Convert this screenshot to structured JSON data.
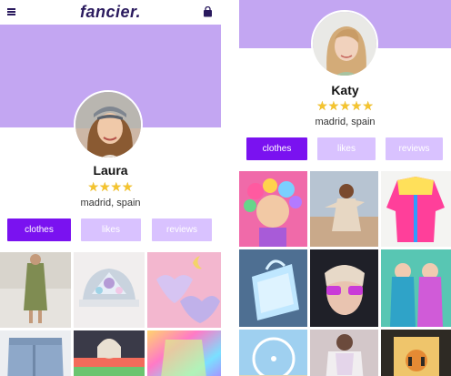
{
  "app": {
    "brand": "fancier.",
    "accent": "#7a12f0",
    "tab_inactive": "#d9c2ff",
    "banner": "#c3a6f2"
  },
  "header": {
    "menu_icon": "hamburger-menu-icon",
    "bag_icon": "shopping-bag-icon"
  },
  "profiles": [
    {
      "name": "Laura",
      "rating": "★★★★",
      "rating_value": 4,
      "location": "madrid, spain",
      "tabs": [
        {
          "label": "clothes",
          "active": true
        },
        {
          "label": "likes",
          "active": false
        },
        {
          "label": "reviews",
          "active": false
        }
      ],
      "photos": [
        "green-dress-photo",
        "jeweled-cap-photo",
        "heart-glasses-photo",
        "denim-shorts-photo",
        "rainbow-outfit-photo",
        "holographic-top-photo"
      ]
    },
    {
      "name": "Katy",
      "rating": "★★★★★",
      "rating_value": 5,
      "location": "madrid, spain",
      "tabs": [
        {
          "label": "clothes",
          "active": true
        },
        {
          "label": "likes",
          "active": false
        },
        {
          "label": "reviews",
          "active": false
        }
      ],
      "photos": [
        "flower-crown-photo",
        "festival-dancer-photo",
        "neon-jacket-photo",
        "holographic-bag-photo",
        "purple-sunglasses-photo",
        "mermaid-costume-photo",
        "ferris-wheel-photo",
        "lace-top-photo",
        "tiger-shirt-photo"
      ]
    }
  ]
}
